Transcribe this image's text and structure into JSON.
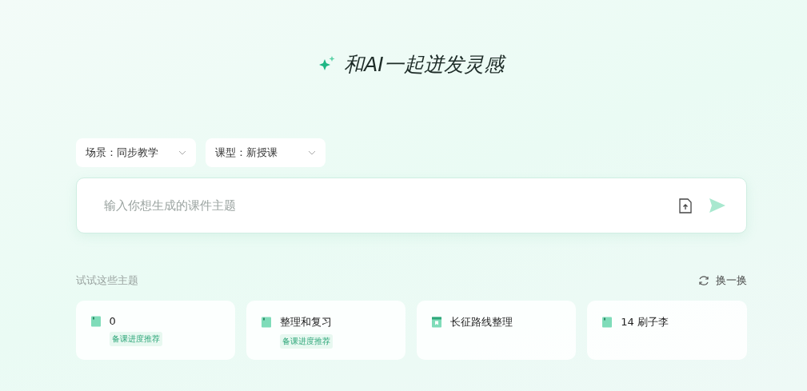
{
  "title": "和AI一起迸发灵感",
  "selectors": [
    {
      "label": "场景：同步教学"
    },
    {
      "label": "课型：新授课"
    }
  ],
  "input": {
    "placeholder": "输入你想生成的课件主题"
  },
  "suggestions": {
    "heading": "试试这些主题",
    "refresh": "换一换",
    "items": [
      {
        "kind": "book",
        "title": "0",
        "tag": "备课进度推荐"
      },
      {
        "kind": "book",
        "title": "整理和复习",
        "tag": "备课进度推荐"
      },
      {
        "kind": "bookmark",
        "title": "长征路线整理"
      },
      {
        "kind": "book",
        "title": "14 刷子李"
      }
    ]
  }
}
